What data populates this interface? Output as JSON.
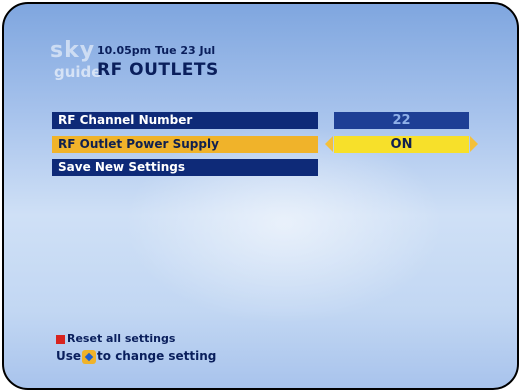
{
  "header": {
    "logo_sky": "sky",
    "logo_guide": "guide",
    "datetime": "10.05pm Tue 23 Jul",
    "title": "RF OUTLETS"
  },
  "menu": {
    "items": [
      {
        "label": "RF Channel Number",
        "value": "22"
      },
      {
        "label": "RF Outlet Power Supply",
        "value": "ON"
      },
      {
        "label": "Save New Settings"
      }
    ]
  },
  "footer": {
    "reset_label": "Reset all settings",
    "use_prefix": "Use",
    "use_suffix": "to change setting"
  },
  "colors": {
    "row_bg": "#0e2a78",
    "highlight_bg": "#f0b32a",
    "value_active_bg": "#f7e02a",
    "red_key": "#d8241f"
  }
}
